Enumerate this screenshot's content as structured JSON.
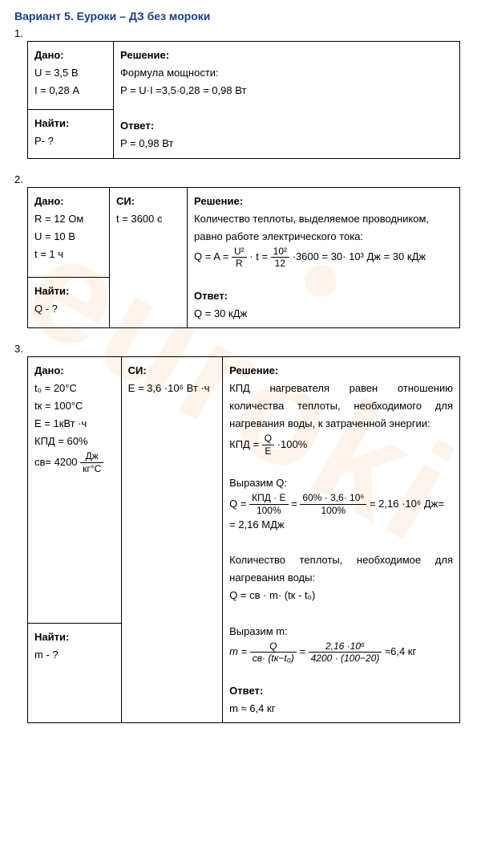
{
  "title": "Вариант 5. Еуроки – ДЗ без мороки",
  "watermark": "euroki",
  "problems": [
    {
      "num": "1.",
      "given_label": "Дано:",
      "given": [
        "U = 3,5 В",
        "I = 0,28 А"
      ],
      "find_label": "Найти:",
      "find": "P- ?",
      "solution_label": "Решение:",
      "solution_lines": [
        "Формула мощности:",
        "P = U·I =3,5·0,28 = 0,98 Вт"
      ],
      "answer_label": "Ответ:",
      "answer": "P = 0,98 Вт"
    },
    {
      "num": "2.",
      "given_label": "Дано:",
      "given": [
        "R = 12 Ом",
        "U = 10 В",
        "t = 1 ч"
      ],
      "find_label": "Найти:",
      "find": "Q - ?",
      "si_label": "СИ:",
      "si": "t = 3600 с",
      "solution_label": "Решение:",
      "solution_text1": "Количество теплоты, выделяемое проводником, равно работе электрического тока:",
      "formula_prefix": "Q = A = ",
      "frac1_n": "U²",
      "frac1_d": "R",
      "mid1": " · t = ",
      "frac2_n": "10²",
      "frac2_d": "12",
      "formula_suffix": " ·3600 = 30· 10³ Дж = 30 кДж",
      "answer_label": "Ответ:",
      "answer": "Q = 30 кДж"
    },
    {
      "num": "3.",
      "given_label": "Дано:",
      "given_t0": "t₀ = 20°C",
      "given_tk": "tк = 100°C",
      "given_E": "E = 1кВт ·ч",
      "given_kpd": "КПД = 60%",
      "given_cv_prefix": "cв= 4200 ",
      "given_cv_frac_n": "Дж",
      "given_cv_frac_d": "кг°С",
      "find_label": "Найти:",
      "find": "m - ?",
      "si_label": "СИ:",
      "si": "E = 3,6 ·10⁶ Вт ·ч",
      "solution_label": "Решение:",
      "text1": "КПД нагревателя равен отношению количества теплоты, необходимого для нагревания воды, к затраченной энергии:",
      "f1_prefix": "КПД = ",
      "f1_n": "Q",
      "f1_d": "E",
      "f1_suffix": " ·100%",
      "text2": "Выразим Q:",
      "f2_prefix": "Q = ",
      "f2a_n": "КПД · E",
      "f2a_d": "100%",
      "f2_mid": " = ",
      "f2b_n": "60% · 3,6· 10⁶",
      "f2b_d": "100%",
      "f2_suffix": " = 2,16 ·10⁶ Дж=",
      "f2_line2": "= 2,16 МДж",
      "text3": "Количество теплоты, необходимое для нагревания воды:",
      "f3": "Q = cв · m· (tк - t₀)",
      "text4": "Выразим m:",
      "f4_prefix": "m = ",
      "f4a_n": "Q",
      "f4a_d": "cв· (tк−t₀)",
      "f4_mid": " = ",
      "f4b_n": "2,16 ·10⁶",
      "f4b_d": "4200 · (100−20)",
      "f4_suffix": " ≈6,4 кг",
      "answer_label": "Ответ:",
      "answer": "m ≈ 6,4 кг"
    }
  ]
}
